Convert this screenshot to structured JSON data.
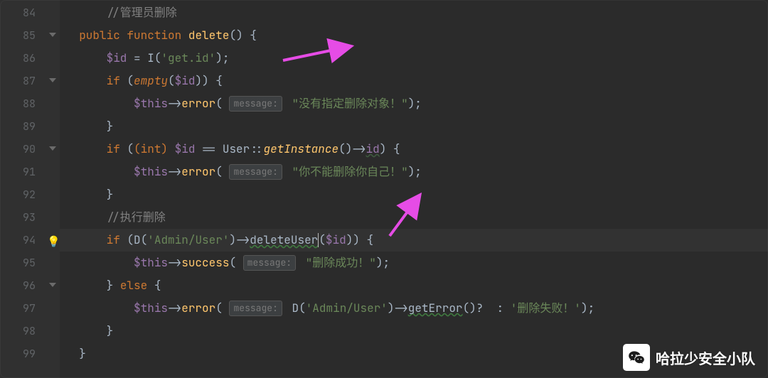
{
  "editor": {
    "first_line": 84,
    "highlighted_line_index": 10,
    "lines": [
      {
        "num": "84",
        "fold": "",
        "bulb": false
      },
      {
        "num": "85",
        "fold": "down",
        "bulb": false
      },
      {
        "num": "86",
        "fold": "",
        "bulb": false
      },
      {
        "num": "87",
        "fold": "down",
        "bulb": false
      },
      {
        "num": "88",
        "fold": "",
        "bulb": false
      },
      {
        "num": "89",
        "fold": "",
        "bulb": false
      },
      {
        "num": "90",
        "fold": "down",
        "bulb": false
      },
      {
        "num": "91",
        "fold": "",
        "bulb": false
      },
      {
        "num": "92",
        "fold": "",
        "bulb": false
      },
      {
        "num": "93",
        "fold": "",
        "bulb": false
      },
      {
        "num": "94",
        "fold": "down",
        "bulb": true
      },
      {
        "num": "95",
        "fold": "",
        "bulb": false
      },
      {
        "num": "96",
        "fold": "down",
        "bulb": false
      },
      {
        "num": "97",
        "fold": "",
        "bulb": false
      },
      {
        "num": "98",
        "fold": "",
        "bulb": false
      },
      {
        "num": "99",
        "fold": "",
        "bulb": false
      }
    ],
    "comment_admin_delete": "//管理员删除",
    "kw_public": "public",
    "kw_function": "function",
    "fn_delete": "delete",
    "paren_o": "(",
    "paren_c": ")",
    "brace_o": " {",
    "brace_c": "}",
    "var_id": "$id",
    "eq": " = ",
    "fn_I": "I",
    "str_get_id": "'get.id'",
    "semi": ";",
    "kw_if": "if",
    "fn_empty": "empty",
    "var_this": "$this",
    "arrow_op": "->",
    "fn_error": "error",
    "hint_msg": "message:",
    "str_no_target": "\"没有指定删除对象！\"",
    "kw_int_cast": "(int) ",
    "eq2": " == ",
    "cls_User": "User",
    "scope": "::",
    "fn_getInstance": "getInstance",
    "prop_id": "id",
    "str_not_self": "\"你不能删除你自己！\"",
    "comment_exec": "//执行删除",
    "fn_D": "D",
    "str_admin_user": "'Admin/User'",
    "fn_deleteUser": "deleteUser",
    "fn_success": "success",
    "str_del_ok": "\"删除成功！\"",
    "kw_else": " else ",
    "fn_getError": "getError",
    "tern_q": "? ",
    "tern_c": " : ",
    "str_del_fail": "'删除失败！'",
    "bulb_glyph": "💡"
  },
  "watermark": {
    "text": "哈拉少安全小队"
  }
}
